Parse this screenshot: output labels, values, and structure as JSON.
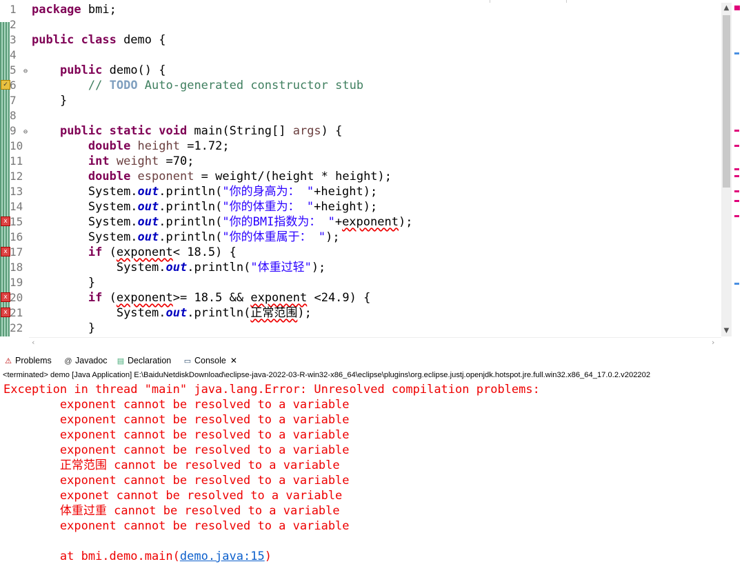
{
  "line_numbers": [
    "1",
    "2",
    "3",
    "4",
    "5",
    "6",
    "7",
    "8",
    "9",
    "10",
    "11",
    "12",
    "13",
    "14",
    "15",
    "16",
    "17",
    "18",
    "19",
    "20",
    "21",
    "22"
  ],
  "code": {
    "l1_kw": "package",
    "l1_rest": " bmi;",
    "l3_kw": "public class",
    "l3_rest": " demo {",
    "l5_kw": "public",
    "l5_rest": " demo() {",
    "l6_comment": "// ",
    "l6_todo": "TODO",
    "l6_rest": " Auto-generated constructor stub",
    "l7": "}",
    "l9_kw": "public static void",
    "l9_mid": " main(String[] ",
    "l9_var": "args",
    "l9_end": ") {",
    "l10_kw": "double",
    "l10_var": " height",
    "l10_end": " =1.72;",
    "l11_kw": "int",
    "l11_var": " weight",
    "l11_end": " =70;",
    "l12_kw": "double",
    "l12_var": " esponent",
    "l12_end": " = weight/(height * height);",
    "sys": "System.",
    "out": "out",
    "println": ".println(",
    "l13_str": "\"你的身高为： \"",
    "l13_end": "+height);",
    "l14_str": "\"你的体重为： \"",
    "l14_end": "+height);",
    "l15_str": "\"你的BMI指数为： \"",
    "l15_plus": "+",
    "l15_err": "exponent",
    "l15_end": ");",
    "l16_str": "\"你的体重属于： \"",
    "l16_end": ");",
    "if": "if",
    "l17_open": " (",
    "l17_err": "exponent",
    "l17_end": "< 18.5) {",
    "l18_str": "\"体重过轻\"",
    "l18_end": ");",
    "l19": "}",
    "l20_open": " (",
    "l20_err1": "exponent",
    "l20_mid": ">= 18.5 && ",
    "l20_err2": "exponent",
    "l20_end": " <24.9) {",
    "l21_err": "正常范围",
    "l21_end": ");",
    "l22": "}"
  },
  "tabs": {
    "problems": "Problems",
    "javadoc": "Javadoc",
    "declaration": "Declaration",
    "console": "Console"
  },
  "status_line": "<terminated> demo [Java Application] E:\\BaiduNetdiskDownload\\eclipse-java-2022-03-R-win32-x86_64\\eclipse\\plugins\\org.eclipse.justj.openjdk.hotspot.jre.full.win32.x86_64_17.0.2.v202202",
  "console": {
    "line0": "Exception in thread \"main\" java.lang.Error: Unresolved compilation problems: ",
    "errors": [
      "exponent cannot be resolved to a variable",
      "exponent cannot be resolved to a variable",
      "exponent cannot be resolved to a variable",
      "exponent cannot be resolved to a variable",
      "正常范围 cannot be resolved to a variable",
      "exponent cannot be resolved to a variable",
      "exponet cannot be resolved to a variable",
      "体重过重 cannot be resolved to a variable",
      "exponent cannot be resolved to a variable"
    ],
    "at_prefix": "at bmi.demo.main(",
    "at_link": "demo.java:15",
    "at_suffix": ")"
  },
  "colors": {
    "error_red": "#e00000",
    "keyword": "#7f0055",
    "string": "#2a00ff",
    "link": "#0b5fcc"
  }
}
